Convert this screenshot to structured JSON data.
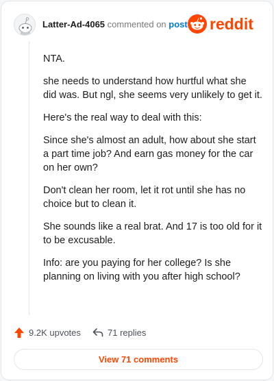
{
  "header": {
    "username": "Latter-Ad-4065",
    "commented_text": "commented on",
    "post_link": "post",
    "brand": "reddit"
  },
  "comment": {
    "paragraphs": [
      "NTA.",
      "she needs to understand how hurtful what she did was. But ngl, she seems very unlikely to get it.",
      "Here's the real way to deal with this:",
      "Since she's almost an adult, how about she start a part time job? And earn gas money for the car on her own?",
      "Don't clean her room, let it rot until she has no choice but to clean it.",
      "She sounds like a real brat. And 17 is too old for it to be excusable.",
      "Info: are you paying for her college? Is she planning on living with you after high school?"
    ]
  },
  "actions": {
    "upvotes": "9.2K upvotes",
    "replies": "71 replies"
  },
  "footer": {
    "view_comments": "View 71 comments"
  },
  "colors": {
    "accent": "#ff4500",
    "link": "#0079d3"
  }
}
